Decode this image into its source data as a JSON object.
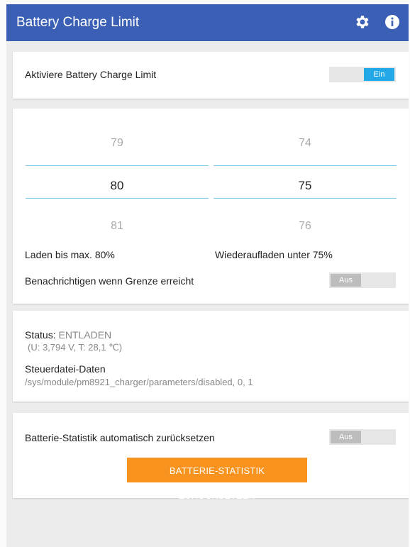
{
  "appbar": {
    "title": "Battery Charge Limit",
    "settings_icon": "gear-icon",
    "info_icon": "info-icon",
    "color": "#3a5fb5"
  },
  "enable_card": {
    "label": "Aktiviere Battery Charge Limit",
    "toggle_state": "Ein",
    "toggle_on": true,
    "accent": "#22a8e6"
  },
  "limits_card": {
    "max_picker": {
      "prev": "79",
      "current": "80",
      "next": "81"
    },
    "recharge_picker": {
      "prev": "74",
      "current": "75",
      "next": "76"
    },
    "max_label": "Laden bis max. 80%",
    "recharge_label": "Wiederaufladen unter 75%",
    "notify_label": "Benachrichtigen wenn Grenze erreicht",
    "notify_toggle_state": "Aus",
    "notify_on": false
  },
  "status_card": {
    "status_label": "Status:",
    "status_value": "ENTLADEN",
    "status_detail": "(U: 3,794 V, T: 28,1 ℃)",
    "ctrl_heading": "Steuerdatei-Daten",
    "ctrl_value": "/sys/module/pm8921_charger/parameters/disabled, 0, 1"
  },
  "stats_card": {
    "auto_reset_label": "Batterie-Statistik automatisch zurücksetzen",
    "auto_reset_state": "Aus",
    "auto_reset_on": false,
    "reset_button": "BATTERIE-STATISTIK ZURÜCKSETZEN",
    "button_color": "#f7931e"
  }
}
